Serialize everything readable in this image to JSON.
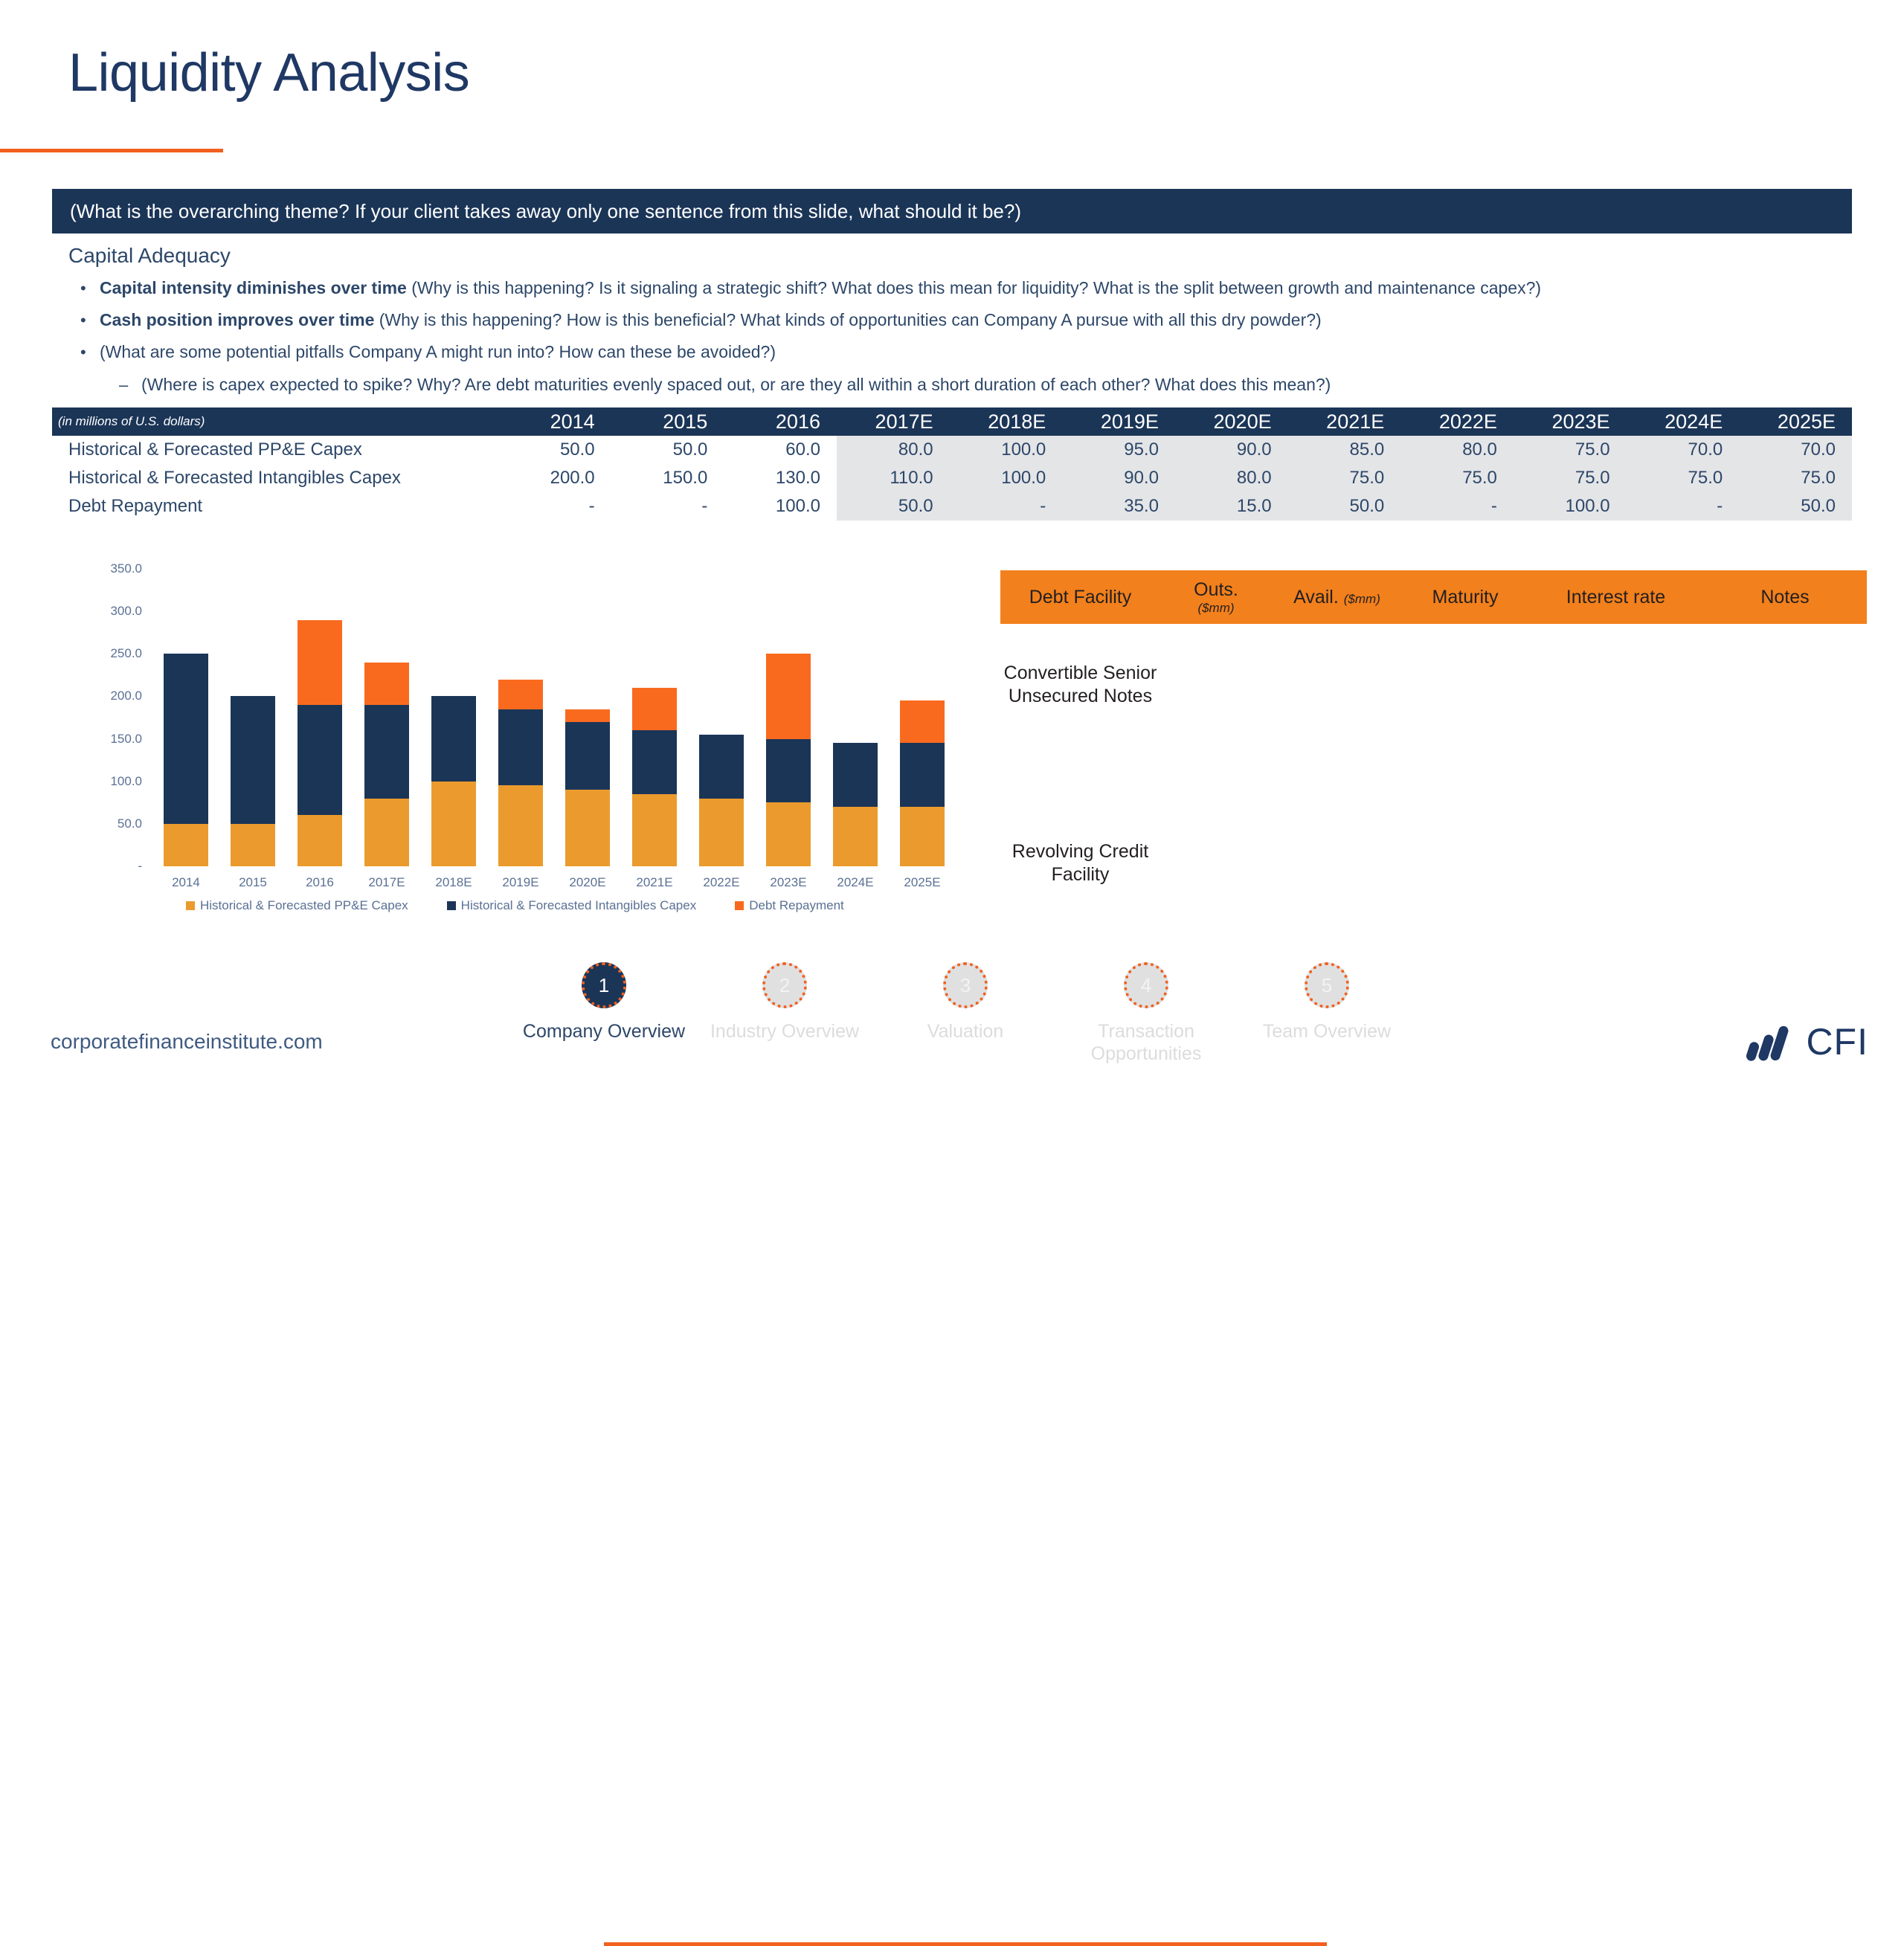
{
  "slide": {
    "title": "Liquidity Analysis",
    "theme_banner": "(What is the overarching theme? If your client takes away only one sentence from this slide, what should it be?)",
    "section_heading": "Capital Adequacy"
  },
  "bullets": [
    {
      "level": 1,
      "marker": "•",
      "strong": "Capital intensity diminishes over time ",
      "rest": "(Why is this happening? Is it signaling a strategic shift? What does this mean for liquidity? What is the split between growth and maintenance capex?)"
    },
    {
      "level": 1,
      "marker": "•",
      "strong": "Cash position improves over time ",
      "rest": "(Why is this happening? How is this beneficial? What kinds of opportunities can Company A pursue with all this dry powder?)"
    },
    {
      "level": 1,
      "marker": "•",
      "strong": "",
      "rest": "(What are some potential pitfalls Company A might run into? How can these be avoided?)"
    },
    {
      "level": 2,
      "marker": "–",
      "strong": "",
      "rest": "(Where is capex expected to spike? Why? Are debt maturities evenly spaced out, or are they all within a short duration of each other? What does this mean?)"
    }
  ],
  "fin_table": {
    "units_label": "(in millions of U.S. dollars)",
    "columns": [
      "2014",
      "2015",
      "2016",
      "2017E",
      "2018E",
      "2019E",
      "2020E",
      "2021E",
      "2022E",
      "2023E",
      "2024E",
      "2025E"
    ],
    "forecast_start_index": 3,
    "rows": [
      {
        "label": "Historical & Forecasted PP&E Capex",
        "values": [
          "50.0",
          "50.0",
          "60.0",
          "80.0",
          "100.0",
          "95.0",
          "90.0",
          "85.0",
          "80.0",
          "75.0",
          "70.0",
          "70.0"
        ]
      },
      {
        "label": "Historical & Forecasted Intangibles Capex",
        "values": [
          "200.0",
          "150.0",
          "130.0",
          "110.0",
          "100.0",
          "90.0",
          "80.0",
          "75.0",
          "75.0",
          "75.0",
          "75.0",
          "75.0"
        ]
      },
      {
        "label": "Debt Repayment",
        "values": [
          "-",
          "-",
          "100.0",
          "50.0",
          "-",
          "35.0",
          "15.0",
          "50.0",
          "-",
          "100.0",
          "-",
          "50.0"
        ]
      }
    ]
  },
  "chart_data": {
    "type": "bar",
    "stacked": true,
    "title": "",
    "xlabel": "",
    "ylabel": "",
    "ylim": [
      0,
      350
    ],
    "yticks": [
      "-",
      "50.0",
      "100.0",
      "150.0",
      "200.0",
      "250.0",
      "300.0",
      "350.0"
    ],
    "ytick_values": [
      0,
      50,
      100,
      150,
      200,
      250,
      300,
      350
    ],
    "grid": false,
    "legend_position": "bottom",
    "categories": [
      "2014",
      "2015",
      "2016",
      "2017E",
      "2018E",
      "2019E",
      "2020E",
      "2021E",
      "2022E",
      "2023E",
      "2024E",
      "2025E"
    ],
    "series": [
      {
        "name": "Historical & Forecasted PP&E Capex",
        "color": "#eb9b2d",
        "values": [
          50,
          50,
          60,
          80,
          100,
          95,
          90,
          85,
          80,
          75,
          70,
          70
        ]
      },
      {
        "name": "Historical & Forecasted Intangibles Capex",
        "color": "#1b3557",
        "values": [
          200,
          150,
          130,
          110,
          100,
          90,
          80,
          75,
          75,
          75,
          75,
          75
        ]
      },
      {
        "name": "Debt Repayment",
        "color": "#f96a1f",
        "values": [
          0,
          0,
          100,
          50,
          0,
          35,
          15,
          50,
          0,
          100,
          0,
          50
        ]
      }
    ],
    "totals": [
      250,
      200,
      290,
      240,
      200,
      220,
      185,
      210,
      155,
      250,
      145,
      195
    ]
  },
  "debt_table": {
    "columns": [
      {
        "id": "facility",
        "label": "Debt Facility",
        "sub": ""
      },
      {
        "id": "outs",
        "label": "Outs.",
        "sub": "($mm)",
        "sub_layout": "block"
      },
      {
        "id": "avail",
        "label": "Avail.",
        "sub": "($mm)",
        "sub_layout": "inline"
      },
      {
        "id": "maturity",
        "label": "Maturity",
        "sub": ""
      },
      {
        "id": "rate",
        "label": "Interest rate",
        "sub": ""
      },
      {
        "id": "notes",
        "label": "Notes",
        "sub": ""
      }
    ],
    "rows": [
      {
        "facility": "Convertible Senior Unsecured Notes",
        "outs": "",
        "avail": "",
        "maturity": "",
        "rate": "",
        "notes": ""
      },
      {
        "facility": "Revolving Credit Facility",
        "outs": "",
        "avail": "",
        "maturity": "",
        "rate": "",
        "notes": ""
      }
    ]
  },
  "stepper": {
    "steps": [
      {
        "number": "1",
        "label": "Company Overview",
        "active": true
      },
      {
        "number": "2",
        "label": "Industry Overview",
        "active": false
      },
      {
        "number": "3",
        "label": "Valuation",
        "active": false
      },
      {
        "number": "4",
        "label": "Transaction Opportunities",
        "active": false
      },
      {
        "number": "5",
        "label": "Team Overview",
        "active": false
      }
    ]
  },
  "footer": {
    "url": "corporatefinanceinstitute.com",
    "logo_text": "CFI"
  },
  "colors": {
    "navy": "#1b3557",
    "orange": "#f2601f",
    "amber": "#eb9b2d",
    "debt_orange": "#f96a1f",
    "header_orange": "#f2801c",
    "text_blue": "#2d4769",
    "forecast_shade": "#e4e5e7"
  }
}
